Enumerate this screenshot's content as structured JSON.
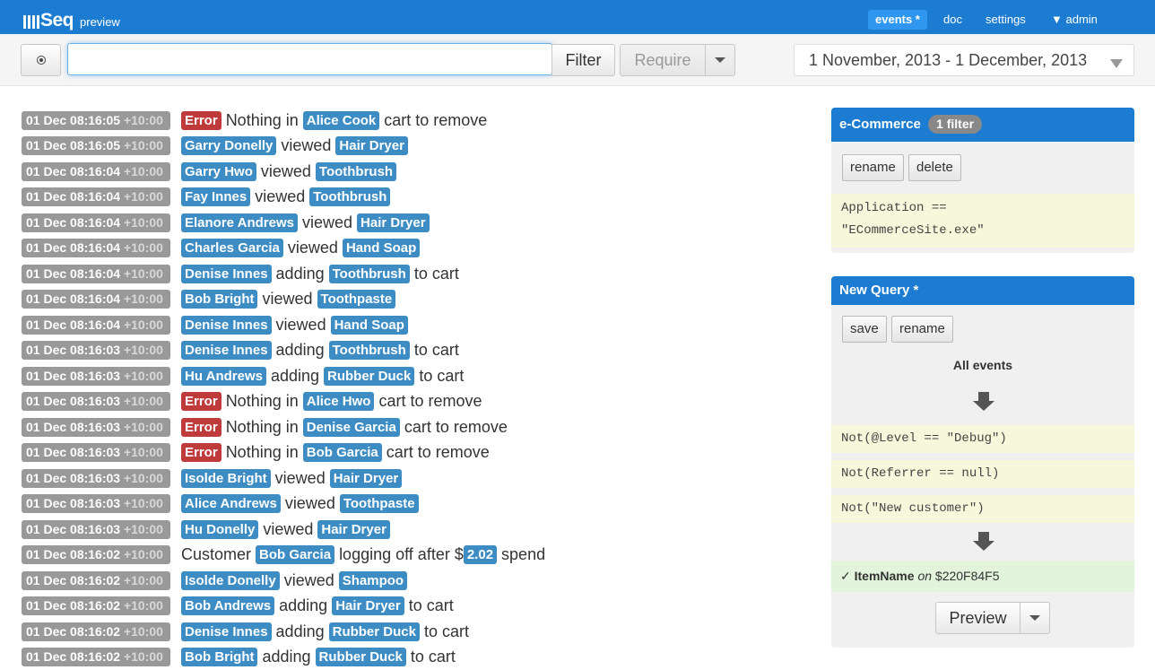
{
  "brand": {
    "name": "Seq",
    "subtitle": "preview"
  },
  "nav": {
    "events": "events *",
    "doc": "doc",
    "settings": "settings",
    "admin": "▼ admin"
  },
  "toolbar": {
    "search_value": "",
    "filter_label": "Filter",
    "require_label": "Require",
    "date_range": "1 November, 2013 - 1 December, 2013"
  },
  "events": [
    {
      "ts": "01 Dec 08:16:05",
      "tz": "+10:00",
      "parts": [
        {
          "t": "tok",
          "c": "red",
          "v": "Error"
        },
        {
          "t": "txt",
          "v": "Nothing in"
        },
        {
          "t": "tok",
          "c": "blue",
          "v": "Alice Cook"
        },
        {
          "t": "txt",
          "v": "cart to remove"
        }
      ]
    },
    {
      "ts": "01 Dec 08:16:05",
      "tz": "+10:00",
      "parts": [
        {
          "t": "tok",
          "c": "blue",
          "v": "Garry Donelly"
        },
        {
          "t": "txt",
          "v": "viewed"
        },
        {
          "t": "tok",
          "c": "blue",
          "v": "Hair Dryer"
        }
      ]
    },
    {
      "ts": "01 Dec 08:16:04",
      "tz": "+10:00",
      "parts": [
        {
          "t": "tok",
          "c": "blue",
          "v": "Garry Hwo"
        },
        {
          "t": "txt",
          "v": "viewed"
        },
        {
          "t": "tok",
          "c": "blue",
          "v": "Toothbrush"
        }
      ]
    },
    {
      "ts": "01 Dec 08:16:04",
      "tz": "+10:00",
      "parts": [
        {
          "t": "tok",
          "c": "blue",
          "v": "Fay Innes"
        },
        {
          "t": "txt",
          "v": "viewed"
        },
        {
          "t": "tok",
          "c": "blue",
          "v": "Toothbrush"
        }
      ]
    },
    {
      "ts": "01 Dec 08:16:04",
      "tz": "+10:00",
      "parts": [
        {
          "t": "tok",
          "c": "blue",
          "v": "Elanore Andrews"
        },
        {
          "t": "txt",
          "v": "viewed"
        },
        {
          "t": "tok",
          "c": "blue",
          "v": "Hair Dryer"
        }
      ]
    },
    {
      "ts": "01 Dec 08:16:04",
      "tz": "+10:00",
      "parts": [
        {
          "t": "tok",
          "c": "blue",
          "v": "Charles Garcia"
        },
        {
          "t": "txt",
          "v": "viewed"
        },
        {
          "t": "tok",
          "c": "blue",
          "v": "Hand Soap"
        }
      ]
    },
    {
      "ts": "01 Dec 08:16:04",
      "tz": "+10:00",
      "parts": [
        {
          "t": "tok",
          "c": "blue",
          "v": "Denise Innes"
        },
        {
          "t": "txt",
          "v": "adding"
        },
        {
          "t": "tok",
          "c": "blue",
          "v": "Toothbrush"
        },
        {
          "t": "txt",
          "v": "to cart"
        }
      ]
    },
    {
      "ts": "01 Dec 08:16:04",
      "tz": "+10:00",
      "parts": [
        {
          "t": "tok",
          "c": "blue",
          "v": "Bob Bright"
        },
        {
          "t": "txt",
          "v": "viewed"
        },
        {
          "t": "tok",
          "c": "blue",
          "v": "Toothpaste"
        }
      ]
    },
    {
      "ts": "01 Dec 08:16:04",
      "tz": "+10:00",
      "parts": [
        {
          "t": "tok",
          "c": "blue",
          "v": "Denise Innes"
        },
        {
          "t": "txt",
          "v": "viewed"
        },
        {
          "t": "tok",
          "c": "blue",
          "v": "Hand Soap"
        }
      ]
    },
    {
      "ts": "01 Dec 08:16:03",
      "tz": "+10:00",
      "parts": [
        {
          "t": "tok",
          "c": "blue",
          "v": "Denise Innes"
        },
        {
          "t": "txt",
          "v": "adding"
        },
        {
          "t": "tok",
          "c": "blue",
          "v": "Toothbrush"
        },
        {
          "t": "txt",
          "v": "to cart"
        }
      ]
    },
    {
      "ts": "01 Dec 08:16:03",
      "tz": "+10:00",
      "parts": [
        {
          "t": "tok",
          "c": "blue",
          "v": "Hu Andrews"
        },
        {
          "t": "txt",
          "v": "adding"
        },
        {
          "t": "tok",
          "c": "blue",
          "v": "Rubber Duck"
        },
        {
          "t": "txt",
          "v": "to cart"
        }
      ]
    },
    {
      "ts": "01 Dec 08:16:03",
      "tz": "+10:00",
      "parts": [
        {
          "t": "tok",
          "c": "red",
          "v": "Error"
        },
        {
          "t": "txt",
          "v": "Nothing in"
        },
        {
          "t": "tok",
          "c": "blue",
          "v": "Alice Hwo"
        },
        {
          "t": "txt",
          "v": "cart to remove"
        }
      ]
    },
    {
      "ts": "01 Dec 08:16:03",
      "tz": "+10:00",
      "parts": [
        {
          "t": "tok",
          "c": "red",
          "v": "Error"
        },
        {
          "t": "txt",
          "v": "Nothing in"
        },
        {
          "t": "tok",
          "c": "blue",
          "v": "Denise Garcia"
        },
        {
          "t": "txt",
          "v": "cart to remove"
        }
      ]
    },
    {
      "ts": "01 Dec 08:16:03",
      "tz": "+10:00",
      "parts": [
        {
          "t": "tok",
          "c": "red",
          "v": "Error"
        },
        {
          "t": "txt",
          "v": "Nothing in"
        },
        {
          "t": "tok",
          "c": "blue",
          "v": "Bob Garcia"
        },
        {
          "t": "txt",
          "v": "cart to remove"
        }
      ]
    },
    {
      "ts": "01 Dec 08:16:03",
      "tz": "+10:00",
      "parts": [
        {
          "t": "tok",
          "c": "blue",
          "v": "Isolde Bright"
        },
        {
          "t": "txt",
          "v": "viewed"
        },
        {
          "t": "tok",
          "c": "blue",
          "v": "Hair Dryer"
        }
      ]
    },
    {
      "ts": "01 Dec 08:16:03",
      "tz": "+10:00",
      "parts": [
        {
          "t": "tok",
          "c": "blue",
          "v": "Alice Andrews"
        },
        {
          "t": "txt",
          "v": "viewed"
        },
        {
          "t": "tok",
          "c": "blue",
          "v": "Toothpaste"
        }
      ]
    },
    {
      "ts": "01 Dec 08:16:03",
      "tz": "+10:00",
      "parts": [
        {
          "t": "tok",
          "c": "blue",
          "v": "Hu Donelly"
        },
        {
          "t": "txt",
          "v": "viewed"
        },
        {
          "t": "tok",
          "c": "blue",
          "v": "Hair Dryer"
        }
      ]
    },
    {
      "ts": "01 Dec 08:16:02",
      "tz": "+10:00",
      "parts": [
        {
          "t": "txt",
          "v": "Customer"
        },
        {
          "t": "tok",
          "c": "blue",
          "v": "Bob Garcia"
        },
        {
          "t": "txt",
          "v": "logging off after $"
        },
        {
          "t": "tok",
          "c": "blue",
          "v": "2.02"
        },
        {
          "t": "txt",
          "v": "spend"
        }
      ]
    },
    {
      "ts": "01 Dec 08:16:02",
      "tz": "+10:00",
      "parts": [
        {
          "t": "tok",
          "c": "blue",
          "v": "Isolde Donelly"
        },
        {
          "t": "txt",
          "v": "viewed"
        },
        {
          "t": "tok",
          "c": "blue",
          "v": "Shampoo"
        }
      ]
    },
    {
      "ts": "01 Dec 08:16:02",
      "tz": "+10:00",
      "parts": [
        {
          "t": "tok",
          "c": "blue",
          "v": "Bob Andrews"
        },
        {
          "t": "txt",
          "v": "adding"
        },
        {
          "t": "tok",
          "c": "blue",
          "v": "Hair Dryer"
        },
        {
          "t": "txt",
          "v": "to cart"
        }
      ]
    },
    {
      "ts": "01 Dec 08:16:02",
      "tz": "+10:00",
      "parts": [
        {
          "t": "tok",
          "c": "blue",
          "v": "Denise Innes"
        },
        {
          "t": "txt",
          "v": "adding"
        },
        {
          "t": "tok",
          "c": "blue",
          "v": "Rubber Duck"
        },
        {
          "t": "txt",
          "v": "to cart"
        }
      ]
    },
    {
      "ts": "01 Dec 08:16:02",
      "tz": "+10:00",
      "parts": [
        {
          "t": "tok",
          "c": "blue",
          "v": "Bob Bright"
        },
        {
          "t": "txt",
          "v": "adding"
        },
        {
          "t": "tok",
          "c": "blue",
          "v": "Rubber Duck"
        },
        {
          "t": "txt",
          "v": "to cart"
        }
      ]
    }
  ],
  "ecommerce_panel": {
    "title": "e-Commerce",
    "badge": "1 filter",
    "rename_label": "rename",
    "delete_label": "delete",
    "filter_line1": "Application ==",
    "filter_line2": "\"ECommerceSite.exe\""
  },
  "query_panel": {
    "title": "New Query *",
    "save_label": "save",
    "rename_label": "rename",
    "all_events": "All events",
    "filters": [
      "Not(@Level == \"Debug\")",
      "Not(Referrer == null)",
      "Not(\"New customer\")"
    ],
    "result_check": "✓",
    "result_name": "ItemName",
    "result_on": "on",
    "result_id": "$220F84F5",
    "preview_label": "Preview"
  },
  "colors": {
    "navbar": "#1c7cd1",
    "token_blue": "#3d8cc4",
    "token_red": "#bf3b3b",
    "timestamp": "#999999",
    "code_bg": "#f7f7dc",
    "result_bg": "#e2f5dc"
  }
}
